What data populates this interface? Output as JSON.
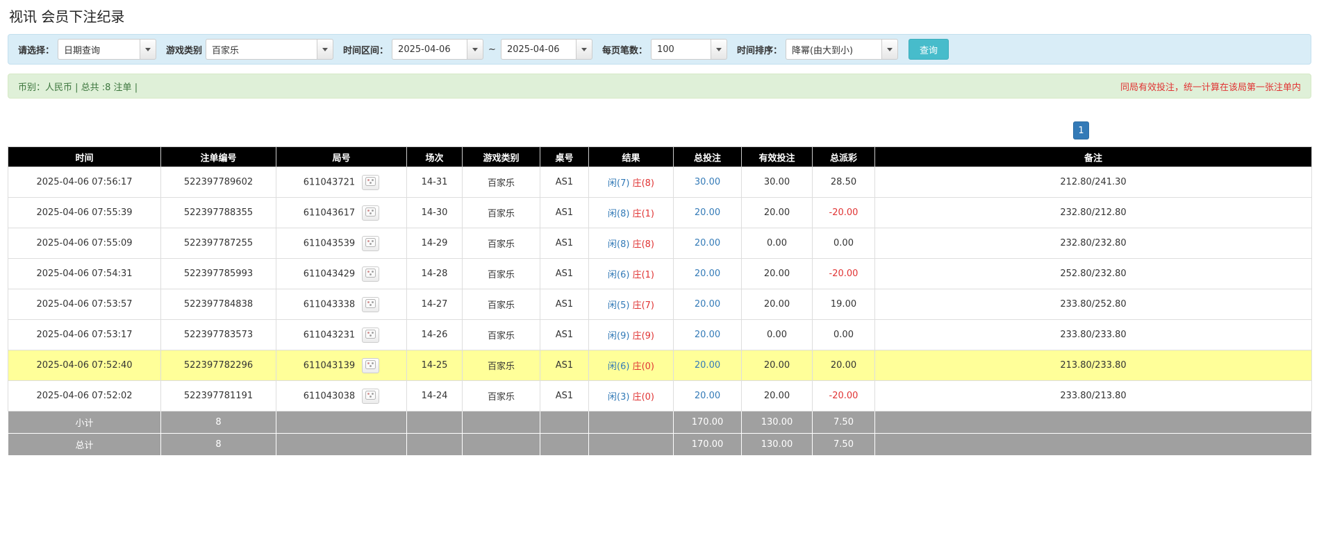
{
  "page": {
    "title": "视讯 会员下注纪录"
  },
  "filters": {
    "select_label": "请选择：",
    "select_value": "日期查询",
    "game_label": "游戏类别",
    "game_value": "百家乐",
    "range_label": "时间区间：",
    "date_from": "2025-04-06",
    "range_separator": "~",
    "date_to": "2025-04-06",
    "per_page_label": "每页笔数：",
    "per_page_value": "100",
    "sort_label": "时间排序：",
    "sort_value": "降幂(由大到小)",
    "search_button_label": "查询"
  },
  "summary": {
    "left_text": "币别：人民币 | 总共 :8 注单 |",
    "right_text": "同局有效投注，统一计算在该局第一张注单内"
  },
  "pagination": {
    "current": "1"
  },
  "icons": {
    "combo_arrow": "caret-down",
    "round_media": "dice"
  },
  "colors": {
    "filter_bg": "#d9edf7",
    "summary_bg": "#dff0d8",
    "header_bg": "#000000",
    "footer_bg": "#a0a0a0",
    "highlight_row": "#ffff99",
    "link_blue": "#337ab7",
    "negative_red": "#e03333",
    "player_blue": "#337ab7",
    "banker_red": "#e03333",
    "search_button": "#47bccb",
    "pagination_blue": "#337ab7"
  },
  "table": {
    "headers": [
      "时间",
      "注单编号",
      "局号",
      "场次",
      "游戏类别",
      "桌号",
      "结果",
      "总投注",
      "有效投注",
      "总派彩",
      "备注"
    ],
    "rows": [
      {
        "time": "2025-04-06 07:56:17",
        "bet_id": "522397789602",
        "round_id": "611043721",
        "session": "14-31",
        "game": "百家乐",
        "table_no": "AS1",
        "result_player": "闲(7)",
        "result_banker": "庄(8)",
        "total_bet": "30.00",
        "valid_bet": "30.00",
        "payout": "28.50",
        "remark": "212.80/241.30",
        "highlighted": false
      },
      {
        "time": "2025-04-06 07:55:39",
        "bet_id": "522397788355",
        "round_id": "611043617",
        "session": "14-30",
        "game": "百家乐",
        "table_no": "AS1",
        "result_player": "闲(8)",
        "result_banker": "庄(1)",
        "total_bet": "20.00",
        "valid_bet": "20.00",
        "payout": "-20.00",
        "remark": "232.80/212.80",
        "highlighted": false
      },
      {
        "time": "2025-04-06 07:55:09",
        "bet_id": "522397787255",
        "round_id": "611043539",
        "session": "14-29",
        "game": "百家乐",
        "table_no": "AS1",
        "result_player": "闲(8)",
        "result_banker": "庄(8)",
        "total_bet": "20.00",
        "valid_bet": "0.00",
        "payout": "0.00",
        "remark": "232.80/232.80",
        "highlighted": false
      },
      {
        "time": "2025-04-06 07:54:31",
        "bet_id": "522397785993",
        "round_id": "611043429",
        "session": "14-28",
        "game": "百家乐",
        "table_no": "AS1",
        "result_player": "闲(6)",
        "result_banker": "庄(1)",
        "total_bet": "20.00",
        "valid_bet": "20.00",
        "payout": "-20.00",
        "remark": "252.80/232.80",
        "highlighted": false
      },
      {
        "time": "2025-04-06 07:53:57",
        "bet_id": "522397784838",
        "round_id": "611043338",
        "session": "14-27",
        "game": "百家乐",
        "table_no": "AS1",
        "result_player": "闲(5)",
        "result_banker": "庄(7)",
        "total_bet": "20.00",
        "valid_bet": "20.00",
        "payout": "19.00",
        "remark": "233.80/252.80",
        "highlighted": false
      },
      {
        "time": "2025-04-06 07:53:17",
        "bet_id": "522397783573",
        "round_id": "611043231",
        "session": "14-26",
        "game": "百家乐",
        "table_no": "AS1",
        "result_player": "闲(9)",
        "result_banker": "庄(9)",
        "total_bet": "20.00",
        "valid_bet": "0.00",
        "payout": "0.00",
        "remark": "233.80/233.80",
        "highlighted": false
      },
      {
        "time": "2025-04-06 07:52:40",
        "bet_id": "522397782296",
        "round_id": "611043139",
        "session": "14-25",
        "game": "百家乐",
        "table_no": "AS1",
        "result_player": "闲(6)",
        "result_banker": "庄(0)",
        "total_bet": "20.00",
        "valid_bet": "20.00",
        "payout": "20.00",
        "remark": "213.80/233.80",
        "highlighted": true
      },
      {
        "time": "2025-04-06 07:52:02",
        "bet_id": "522397781191",
        "round_id": "611043038",
        "session": "14-24",
        "game": "百家乐",
        "table_no": "AS1",
        "result_player": "闲(3)",
        "result_banker": "庄(0)",
        "total_bet": "20.00",
        "valid_bet": "20.00",
        "payout": "-20.00",
        "remark": "233.80/213.80",
        "highlighted": false
      }
    ],
    "footer_rows": [
      {
        "label": "小计",
        "count": "8",
        "total_bet": "170.00",
        "valid_bet": "130.00",
        "payout": "7.50"
      },
      {
        "label": "总计",
        "count": "8",
        "total_bet": "170.00",
        "valid_bet": "130.00",
        "payout": "7.50"
      }
    ]
  }
}
